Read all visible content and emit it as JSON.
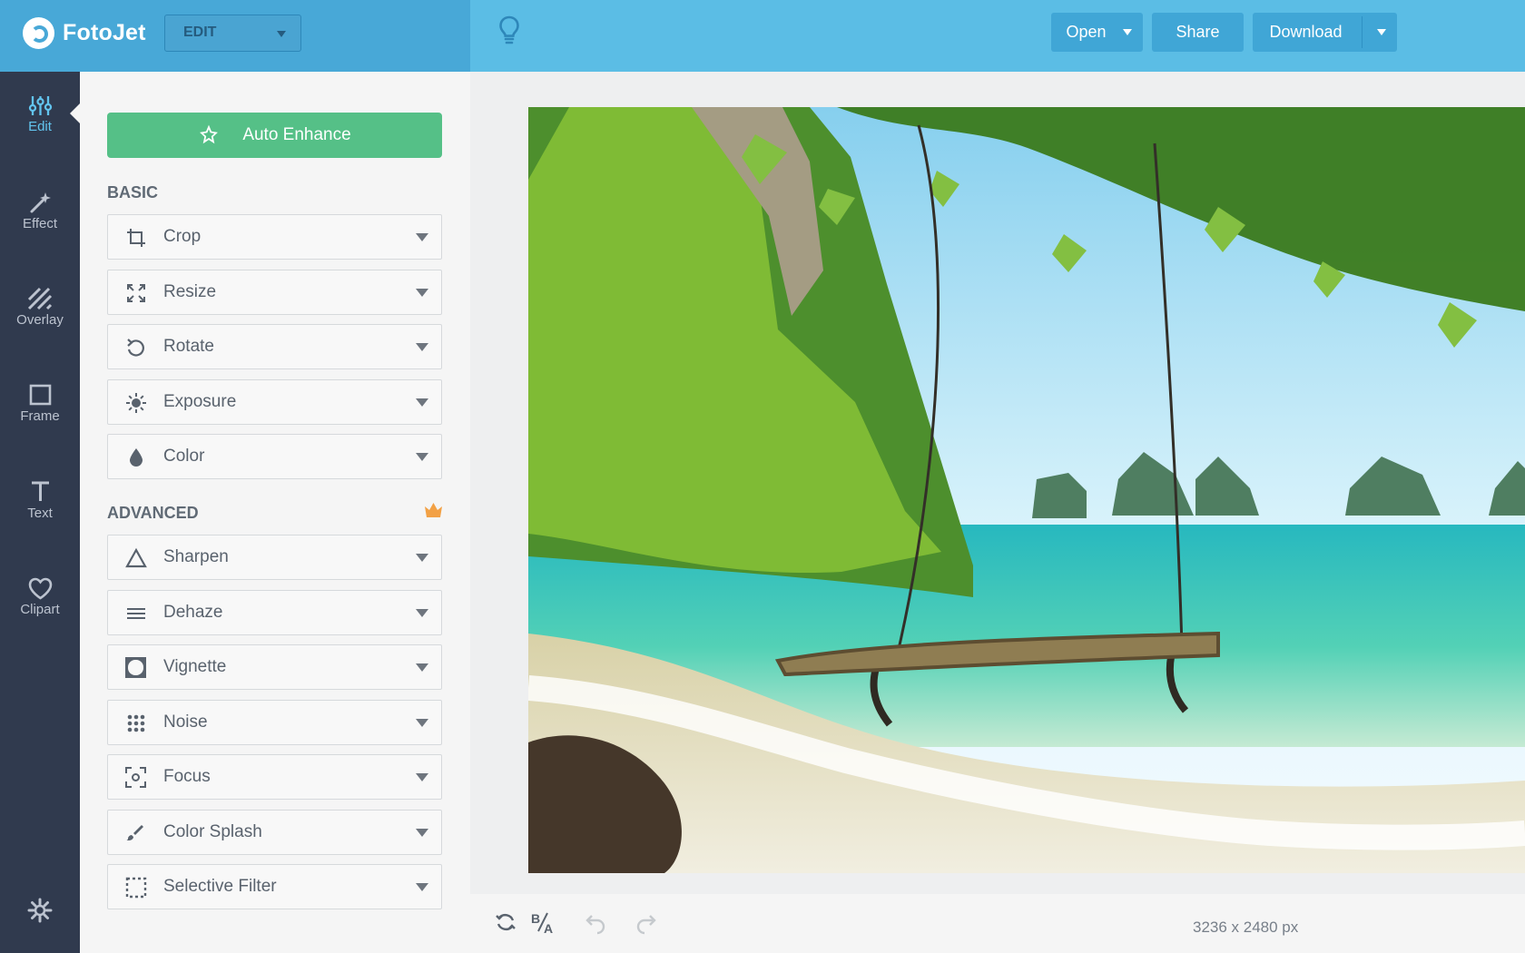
{
  "app": {
    "name": "FotoJet",
    "mode": "EDIT"
  },
  "header": {
    "actions": [
      {
        "label": "Open"
      },
      {
        "label": "Share"
      },
      {
        "label": "Download"
      }
    ]
  },
  "sidebar": {
    "items": [
      {
        "label": "Edit",
        "icon": "edit-icon",
        "active": true
      },
      {
        "label": "Effect",
        "icon": "magic-wand-icon"
      },
      {
        "label": "Overlay",
        "icon": "overlay-icon"
      },
      {
        "label": "Frame",
        "icon": "frame-icon"
      },
      {
        "label": "Text",
        "icon": "text-icon"
      },
      {
        "label": "Clipart",
        "icon": "heart-icon"
      }
    ],
    "settings_icon": "gear-icon"
  },
  "panel": {
    "auto_enhance": "Auto Enhance",
    "basic_title": "BASIC",
    "advanced_title": "ADVANCED",
    "basic": [
      {
        "label": "Crop",
        "icon": "crop-icon"
      },
      {
        "label": "Resize",
        "icon": "resize-icon"
      },
      {
        "label": "Rotate",
        "icon": "rotate-icon"
      },
      {
        "label": "Exposure",
        "icon": "exposure-icon"
      },
      {
        "label": "Color",
        "icon": "color-drop-icon"
      }
    ],
    "advanced": [
      {
        "label": "Sharpen",
        "icon": "sharpen-icon"
      },
      {
        "label": "Dehaze",
        "icon": "dehaze-icon"
      },
      {
        "label": "Vignette",
        "icon": "vignette-icon"
      },
      {
        "label": "Noise",
        "icon": "noise-icon"
      },
      {
        "label": "Focus",
        "icon": "focus-icon"
      },
      {
        "label": "Color Splash",
        "icon": "color-splash-icon"
      },
      {
        "label": "Selective Filter",
        "icon": "selective-filter-icon"
      }
    ]
  },
  "canvas": {
    "dimensions": "3236 x 2480 px"
  },
  "colors": {
    "primary": "#5bbde5",
    "primary_dark": "#48a8d7",
    "sidebar": "#303a4e",
    "success": "#55c087"
  }
}
